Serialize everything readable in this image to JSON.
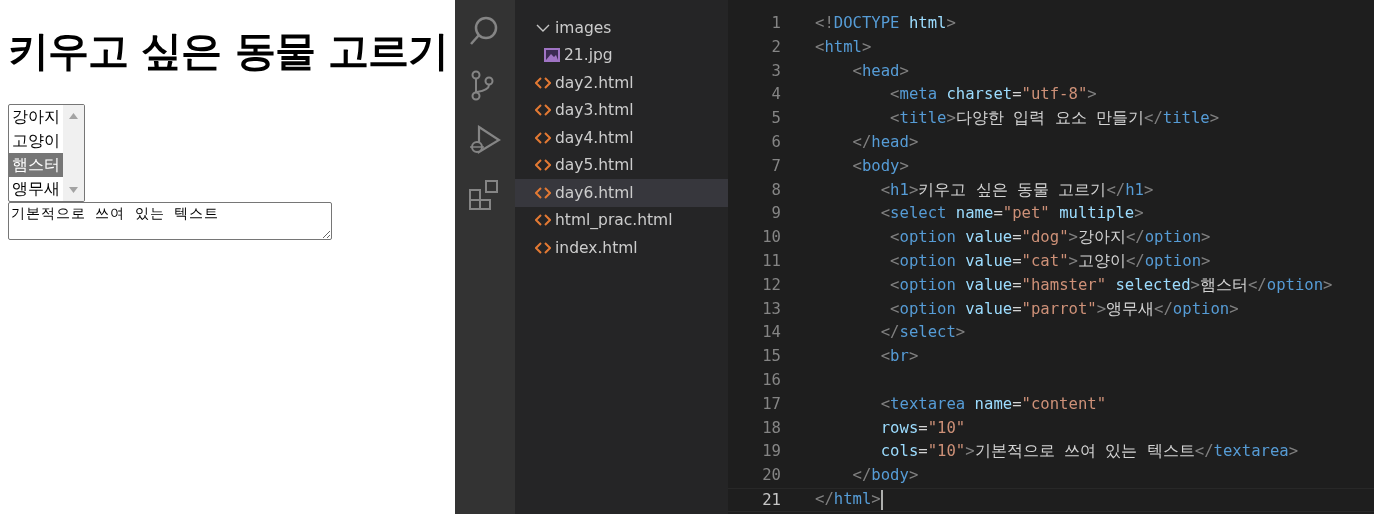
{
  "browser": {
    "heading": "키우고 싶은 동물 고르기",
    "select": {
      "options": [
        {
          "label": "강아지",
          "selected": false
        },
        {
          "label": "고양이",
          "selected": false
        },
        {
          "label": "햄스터",
          "selected": true
        },
        {
          "label": "앵무새",
          "selected": false
        }
      ]
    },
    "textarea": {
      "value": "기본적으로 쓰여 있는 텍스트"
    }
  },
  "explorer": {
    "items": [
      {
        "label": "images",
        "kind": "folder",
        "expanded": true,
        "selected": false,
        "children": [
          {
            "label": "21.jpg",
            "kind": "image",
            "selected": false
          }
        ]
      },
      {
        "label": "day2.html",
        "kind": "html",
        "selected": false
      },
      {
        "label": "day3.html",
        "kind": "html",
        "selected": false
      },
      {
        "label": "day4.html",
        "kind": "html",
        "selected": false
      },
      {
        "label": "day5.html",
        "kind": "html",
        "selected": false
      },
      {
        "label": "day6.html",
        "kind": "html",
        "selected": true
      },
      {
        "label": "html_prac.html",
        "kind": "html",
        "selected": false
      },
      {
        "label": "index.html",
        "kind": "html",
        "selected": false
      }
    ]
  },
  "editor": {
    "lines": [
      {
        "number": "1",
        "current": false,
        "tokens": [
          {
            "t": "<!",
            "kind": "punct"
          },
          {
            "t": "DOCTYPE",
            "kind": "tag"
          },
          {
            "t": " html",
            "kind": "attr"
          },
          {
            "t": ">",
            "kind": "punct"
          }
        ]
      },
      {
        "number": "2",
        "current": false,
        "tokens": [
          {
            "t": "<",
            "kind": "punct"
          },
          {
            "t": "html",
            "kind": "tag"
          },
          {
            "t": ">",
            "kind": "punct"
          }
        ]
      },
      {
        "number": "3",
        "current": false,
        "tokens": [
          {
            "t": "    <",
            "kind": "punct"
          },
          {
            "t": "head",
            "kind": "tag"
          },
          {
            "t": ">",
            "kind": "punct"
          }
        ]
      },
      {
        "number": "4",
        "current": false,
        "tokens": [
          {
            "t": "        <",
            "kind": "punct"
          },
          {
            "t": "meta",
            "kind": "tag"
          },
          {
            "t": " charset",
            "kind": "attr"
          },
          {
            "t": "=",
            "kind": "text"
          },
          {
            "t": "\"utf-8\"",
            "kind": "string"
          },
          {
            "t": ">",
            "kind": "punct"
          }
        ]
      },
      {
        "number": "5",
        "current": false,
        "tokens": [
          {
            "t": "        <",
            "kind": "punct"
          },
          {
            "t": "title",
            "kind": "tag"
          },
          {
            "t": ">",
            "kind": "punct"
          },
          {
            "t": "다양한 입력 요소 만들기",
            "kind": "text"
          },
          {
            "t": "</",
            "kind": "punct"
          },
          {
            "t": "title",
            "kind": "tag"
          },
          {
            "t": ">",
            "kind": "punct"
          }
        ]
      },
      {
        "number": "6",
        "current": false,
        "tokens": [
          {
            "t": "    </",
            "kind": "punct"
          },
          {
            "t": "head",
            "kind": "tag"
          },
          {
            "t": ">",
            "kind": "punct"
          }
        ]
      },
      {
        "number": "7",
        "current": false,
        "tokens": [
          {
            "t": "    <",
            "kind": "punct"
          },
          {
            "t": "body",
            "kind": "tag"
          },
          {
            "t": ">",
            "kind": "punct"
          }
        ]
      },
      {
        "number": "8",
        "current": false,
        "tokens": [
          {
            "t": "       <",
            "kind": "punct"
          },
          {
            "t": "h1",
            "kind": "tag"
          },
          {
            "t": ">",
            "kind": "punct"
          },
          {
            "t": "키우고 싶은 동물 고르기",
            "kind": "text"
          },
          {
            "t": "</",
            "kind": "punct"
          },
          {
            "t": "h1",
            "kind": "tag"
          },
          {
            "t": ">",
            "kind": "punct"
          }
        ]
      },
      {
        "number": "9",
        "current": false,
        "tokens": [
          {
            "t": "       <",
            "kind": "punct"
          },
          {
            "t": "select",
            "kind": "tag"
          },
          {
            "t": " name",
            "kind": "attr"
          },
          {
            "t": "=",
            "kind": "text"
          },
          {
            "t": "\"pet\"",
            "kind": "string"
          },
          {
            "t": " multiple",
            "kind": "attr"
          },
          {
            "t": ">",
            "kind": "punct"
          }
        ]
      },
      {
        "number": "10",
        "current": false,
        "tokens": [
          {
            "t": "        <",
            "kind": "punct"
          },
          {
            "t": "option",
            "kind": "tag"
          },
          {
            "t": " value",
            "kind": "attr"
          },
          {
            "t": "=",
            "kind": "text"
          },
          {
            "t": "\"dog\"",
            "kind": "string"
          },
          {
            "t": ">",
            "kind": "punct"
          },
          {
            "t": "강아지",
            "kind": "text"
          },
          {
            "t": "</",
            "kind": "punct"
          },
          {
            "t": "option",
            "kind": "tag"
          },
          {
            "t": ">",
            "kind": "punct"
          }
        ]
      },
      {
        "number": "11",
        "current": false,
        "tokens": [
          {
            "t": "        <",
            "kind": "punct"
          },
          {
            "t": "option",
            "kind": "tag"
          },
          {
            "t": " value",
            "kind": "attr"
          },
          {
            "t": "=",
            "kind": "text"
          },
          {
            "t": "\"cat\"",
            "kind": "string"
          },
          {
            "t": ">",
            "kind": "punct"
          },
          {
            "t": "고양이",
            "kind": "text"
          },
          {
            "t": "</",
            "kind": "punct"
          },
          {
            "t": "option",
            "kind": "tag"
          },
          {
            "t": ">",
            "kind": "punct"
          }
        ]
      },
      {
        "number": "12",
        "current": false,
        "tokens": [
          {
            "t": "        <",
            "kind": "punct"
          },
          {
            "t": "option",
            "kind": "tag"
          },
          {
            "t": " value",
            "kind": "attr"
          },
          {
            "t": "=",
            "kind": "text"
          },
          {
            "t": "\"hamster\"",
            "kind": "string"
          },
          {
            "t": " selected",
            "kind": "attr"
          },
          {
            "t": ">",
            "kind": "punct"
          },
          {
            "t": "햄스터",
            "kind": "text"
          },
          {
            "t": "</",
            "kind": "punct"
          },
          {
            "t": "option",
            "kind": "tag"
          },
          {
            "t": ">",
            "kind": "punct"
          }
        ]
      },
      {
        "number": "13",
        "current": false,
        "tokens": [
          {
            "t": "        <",
            "kind": "punct"
          },
          {
            "t": "option",
            "kind": "tag"
          },
          {
            "t": " value",
            "kind": "attr"
          },
          {
            "t": "=",
            "kind": "text"
          },
          {
            "t": "\"parrot\"",
            "kind": "string"
          },
          {
            "t": ">",
            "kind": "punct"
          },
          {
            "t": "앵무새",
            "kind": "text"
          },
          {
            "t": "</",
            "kind": "punct"
          },
          {
            "t": "option",
            "kind": "tag"
          },
          {
            "t": ">",
            "kind": "punct"
          }
        ]
      },
      {
        "number": "14",
        "current": false,
        "tokens": [
          {
            "t": "       </",
            "kind": "punct"
          },
          {
            "t": "select",
            "kind": "tag"
          },
          {
            "t": ">",
            "kind": "punct"
          }
        ]
      },
      {
        "number": "15",
        "current": false,
        "tokens": [
          {
            "t": "       <",
            "kind": "punct"
          },
          {
            "t": "br",
            "kind": "tag"
          },
          {
            "t": ">",
            "kind": "punct"
          }
        ]
      },
      {
        "number": "16",
        "current": false
      },
      {
        "number": "17",
        "current": false,
        "tokens": [
          {
            "t": "       <",
            "kind": "punct"
          },
          {
            "t": "textarea",
            "kind": "tag"
          },
          {
            "t": " name",
            "kind": "attr"
          },
          {
            "t": "=",
            "kind": "text"
          },
          {
            "t": "\"content\"",
            "kind": "string"
          }
        ]
      },
      {
        "number": "18",
        "current": false,
        "tokens": [
          {
            "t": "       rows",
            "kind": "attr"
          },
          {
            "t": "=",
            "kind": "text"
          },
          {
            "t": "\"10\"",
            "kind": "string"
          }
        ]
      },
      {
        "number": "19",
        "current": false,
        "tokens": [
          {
            "t": "       cols",
            "kind": "attr"
          },
          {
            "t": "=",
            "kind": "text"
          },
          {
            "t": "\"10\"",
            "kind": "string"
          },
          {
            "t": ">",
            "kind": "punct"
          },
          {
            "t": "기본적으로 쓰여 있는 텍스트",
            "kind": "text"
          },
          {
            "t": "</",
            "kind": "punct"
          },
          {
            "t": "textarea",
            "kind": "tag"
          },
          {
            "t": ">",
            "kind": "punct"
          }
        ]
      },
      {
        "number": "20",
        "current": false,
        "tokens": [
          {
            "t": "    </",
            "kind": "punct"
          },
          {
            "t": "body",
            "kind": "tag"
          },
          {
            "t": ">",
            "kind": "punct"
          }
        ]
      },
      {
        "number": "21",
        "current": true,
        "tokens": [
          {
            "t": "</",
            "kind": "punct"
          },
          {
            "t": "html",
            "kind": "tag"
          },
          {
            "t": ">",
            "kind": "punct"
          }
        ]
      }
    ]
  }
}
